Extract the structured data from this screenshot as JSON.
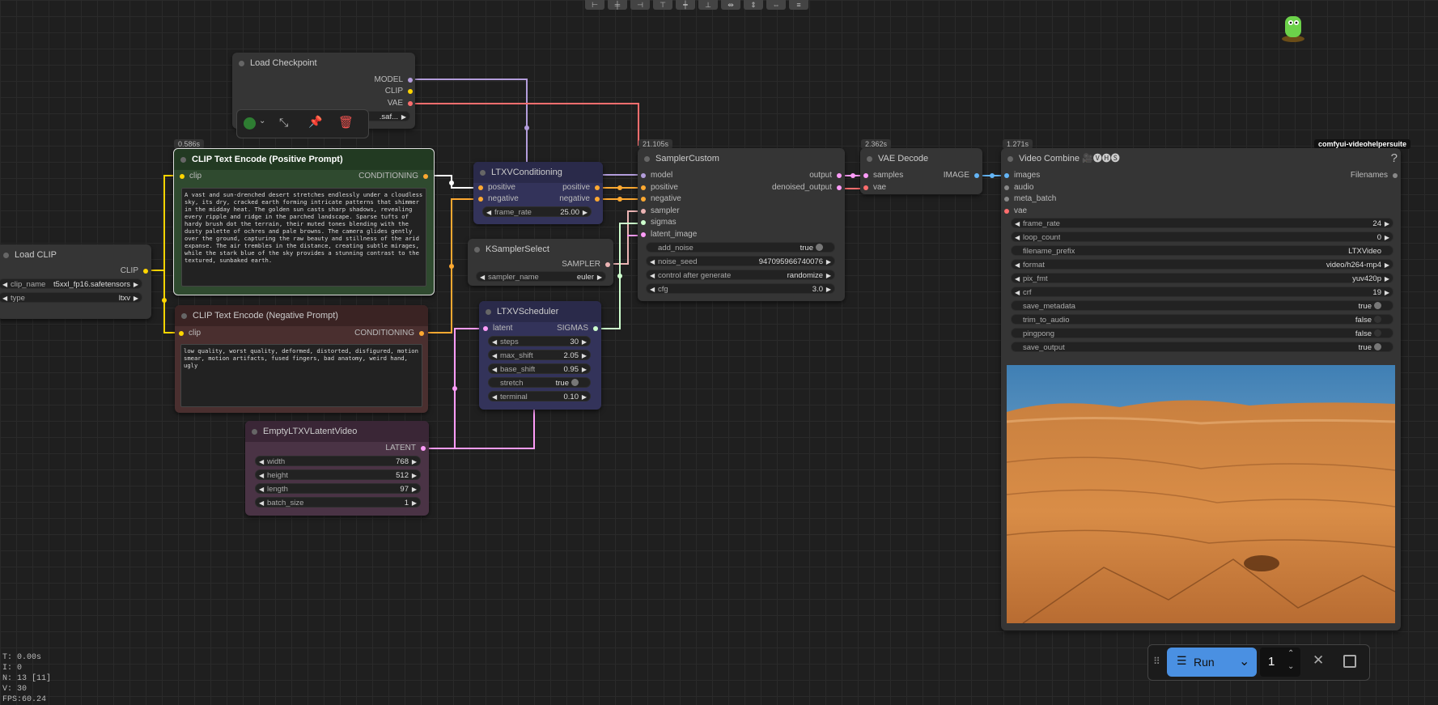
{
  "toolbar": {
    "icons": [
      "align-left-icon",
      "align-center-icon",
      "align-right-icon",
      "align-top-icon",
      "align-middle-icon",
      "align-bottom-icon",
      "distribute-h-icon",
      "distribute-v-icon",
      "stretch-icon",
      "arrange-icon"
    ]
  },
  "ext_badge": "comfyui-videohelpersuite",
  "nodes": {
    "load_checkpoint": {
      "title": "Load Checkpoint",
      "outputs": [
        "MODEL",
        "CLIP",
        "VAE"
      ],
      "ckpt_value": ".saf..."
    },
    "selection_toolbox": {
      "icons": [
        "color-icon",
        "chevron-down-icon",
        "bypass-icon",
        "pin-icon",
        "delete-icon"
      ]
    },
    "clip_pos": {
      "time": "0.586s",
      "title": "CLIP Text Encode (Positive Prompt)",
      "input": "clip",
      "output": "CONDITIONING",
      "text": "A vast and sun-drenched desert stretches endlessly under a cloudless sky, its dry, cracked earth forming intricate patterns that shimmer in the midday heat. The golden sun casts sharp shadows, revealing every ripple and ridge in the parched landscape. Sparse tufts of hardy brush dot the terrain, their muted tones blending with the dusty palette of ochres and pale browns. The camera glides gently over the ground, capturing the raw beauty and stillness of the arid expanse. The air trembles in the distance, creating subtle mirages, while the stark blue of the sky provides a stunning contrast to the textured, sunbaked earth."
    },
    "clip_neg": {
      "title": "CLIP Text Encode (Negative Prompt)",
      "input": "clip",
      "output": "CONDITIONING",
      "text": "low quality, worst quality, deformed, distorted, disfigured, motion smear, motion artifacts, fused fingers, bad anatomy, weird hand, ugly"
    },
    "load_clip": {
      "title": "Load CLIP",
      "output": "CLIP",
      "w1_label": "clip_name",
      "w1_value": "t5xxl_fp16.safetensors",
      "w2_label": "type",
      "w2_value": "ltxv"
    },
    "ltxv_cond": {
      "title": "LTXVConditioning",
      "in1": "positive",
      "in2": "negative",
      "out1": "positive",
      "out2": "negative",
      "w_label": "frame_rate",
      "w_value": "25.00"
    },
    "ksampler_select": {
      "title": "KSamplerSelect",
      "output": "SAMPLER",
      "w_label": "sampler_name",
      "w_value": "euler"
    },
    "ltxv_sched": {
      "title": "LTXVScheduler",
      "input": "latent",
      "output": "SIGMAS",
      "widgets": [
        {
          "label": "steps",
          "value": "30"
        },
        {
          "label": "max_shift",
          "value": "2.05"
        },
        {
          "label": "base_shift",
          "value": "0.95"
        },
        {
          "label": "stretch",
          "value": "true"
        },
        {
          "label": "terminal",
          "value": "0.10"
        }
      ]
    },
    "empty_latent": {
      "title": "EmptyLTXVLatentVideo",
      "output": "LATENT",
      "widgets": [
        {
          "label": "width",
          "value": "768"
        },
        {
          "label": "height",
          "value": "512"
        },
        {
          "label": "length",
          "value": "97"
        },
        {
          "label": "batch_size",
          "value": "1"
        }
      ]
    },
    "sampler_custom": {
      "time": "21.105s",
      "title": "SamplerCustom",
      "inputs": [
        "model",
        "positive",
        "negative",
        "sampler",
        "sigmas",
        "latent_image"
      ],
      "out1": "output",
      "out2": "denoised_output",
      "widgets": [
        {
          "label": "add_noise",
          "value": "true"
        },
        {
          "label": "noise_seed",
          "value": "947095966740076"
        },
        {
          "label": "control after generate",
          "value": "randomize"
        },
        {
          "label": "cfg",
          "value": "3.0"
        }
      ]
    },
    "vae_decode": {
      "time": "2.362s",
      "title": "VAE Decode",
      "in1": "samples",
      "in2": "vae",
      "output": "IMAGE"
    },
    "video_combine": {
      "time": "1.271s",
      "title": "Video Combine 🎥🅥🅗🅢",
      "help": "?",
      "inputs": [
        "images",
        "audio",
        "meta_batch",
        "vae"
      ],
      "output": "Filenames",
      "widgets": [
        {
          "label": "frame_rate",
          "value": "24",
          "arrows": true
        },
        {
          "label": "loop_count",
          "value": "0",
          "arrows": true
        },
        {
          "label": "filename_prefix",
          "value": "LTXVideo",
          "arrows": false
        },
        {
          "label": "format",
          "value": "video/h264-mp4",
          "arrows": true
        },
        {
          "label": "pix_fmt",
          "value": "yuv420p",
          "arrows": true
        },
        {
          "label": "crf",
          "value": "19",
          "arrows": true
        },
        {
          "label": "save_metadata",
          "value": "true",
          "toggle": true
        },
        {
          "label": "trim_to_audio",
          "value": "false",
          "toggle": true
        },
        {
          "label": "pingpong",
          "value": "false",
          "toggle": true
        },
        {
          "label": "save_output",
          "value": "true",
          "toggle": true
        }
      ]
    }
  },
  "run_bar": {
    "run_label": "Run",
    "count": "1"
  },
  "stats": {
    "t": "T: 0.00s",
    "i": "I: 0",
    "n": "N: 13 [11]",
    "v": "V: 30",
    "fps": "FPS:60.24"
  },
  "colors": {
    "clip": "#ffd500",
    "model": "#b39ddb",
    "vae": "#ff6e6e",
    "conditioning": "#ffa931",
    "latent": "#ff9cf9",
    "sampler": "#ecb4b4",
    "sigmas": "#cdffcd",
    "image": "#64b5f6"
  }
}
